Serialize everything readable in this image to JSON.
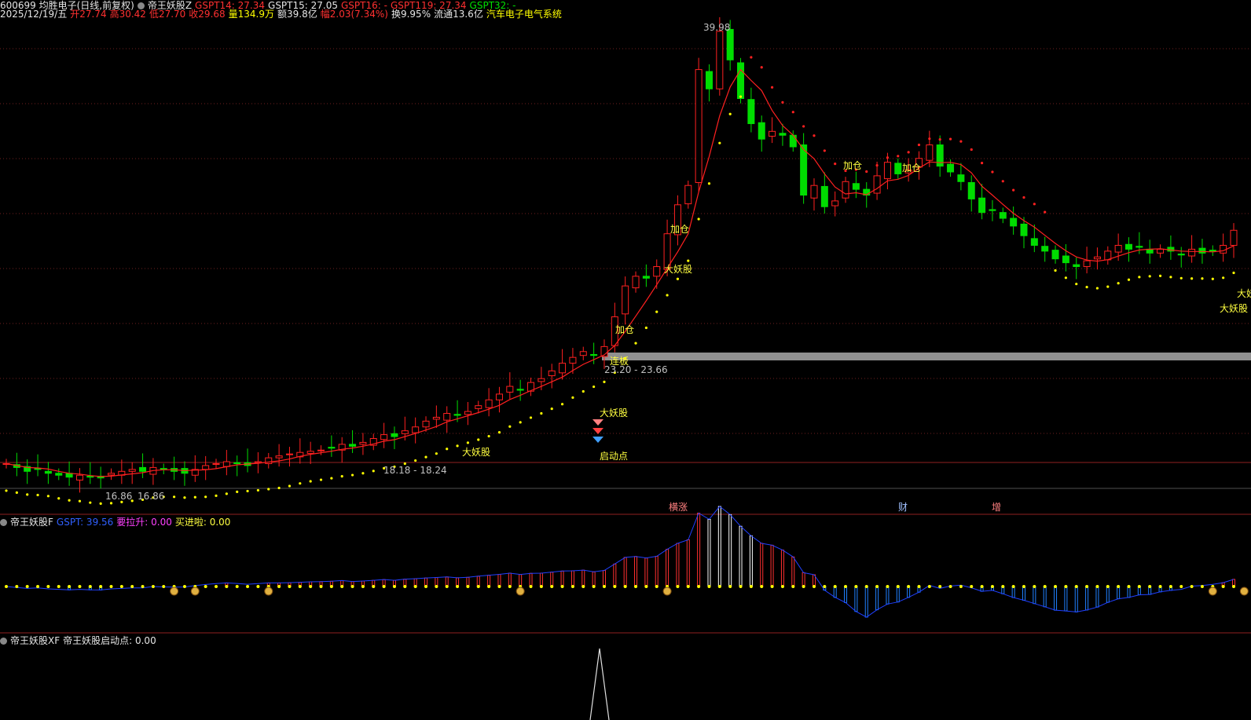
{
  "header": {
    "stock_line": "600699 均胜电子(日线,前复权)",
    "indicator_main": "帝王妖股Z",
    "gspt14": "GSPT14: 27.34",
    "gspt15": "GSPT15: 27.05",
    "gspt16": "GSPT16: -",
    "gspt119": "GSPT119: 27.34",
    "gspt32": "GSPT32: -",
    "date": "2025/12/19/五",
    "open": "开27.74",
    "high": "高30.42",
    "low": "低27.70",
    "close": "收29.68",
    "volume": "量134.9万",
    "amount": "额39.8亿",
    "change": "幅2.03(7.34%)",
    "turnover": "换9.95%",
    "float": "流通13.6亿",
    "sector": "汽车电子电气系统"
  },
  "main_chart": {
    "labels": {
      "peak": "39.98",
      "low_price": "16.86",
      "low_price_prefix": "16.86",
      "range1": "18.18 - 18.24",
      "range2": "23.20 - 23.66",
      "qidong": "启动点",
      "lianban": "连板",
      "dayaogu": "大妖股",
      "jiacang": "加仓",
      "dayaogu_cut": "大妖"
    },
    "event_markers": [
      "横涨",
      "财",
      "增"
    ],
    "colors": {
      "up": "#ff2020",
      "down": "#00dd00",
      "ma": "#ff2020",
      "dots": "#ffff00"
    }
  },
  "sub1": {
    "name": "帝王妖股F",
    "gspt": "GSPT: 39.56",
    "yaolasheng": "要拉升: 0.00",
    "maijinla": "买进啦: 0.00"
  },
  "sub2": {
    "name": "帝王妖股XF",
    "qidong": "帝王妖股启动点: 0.00"
  },
  "chart_data": {
    "type": "candlestick",
    "symbol": "600699",
    "last_bar": {
      "date": "2025/12/19",
      "open": 27.74,
      "high": 30.42,
      "low": 27.7,
      "close": 29.68,
      "change_pct": 7.34
    },
    "close_series": [
      17.6,
      17.4,
      17.2,
      17.3,
      17.1,
      17.0,
      16.9,
      17.0,
      16.9,
      16.86,
      17.1,
      17.2,
      17.3,
      17.2,
      17.4,
      17.3,
      17.2,
      17.1,
      17.3,
      17.5,
      17.6,
      17.7,
      17.6,
      17.5,
      17.7,
      17.9,
      18.0,
      18.1,
      18.18,
      18.24,
      18.3,
      18.4,
      18.6,
      18.5,
      18.7,
      18.9,
      19.1,
      19.0,
      19.3,
      19.5,
      19.8,
      20.0,
      20.2,
      20.1,
      20.3,
      20.6,
      20.9,
      21.2,
      21.6,
      21.4,
      21.8,
      22.0,
      22.4,
      22.8,
      23.1,
      23.4,
      23.2,
      23.66,
      25.2,
      26.8,
      27.3,
      27.2,
      27.8,
      29.5,
      31.0,
      32.0,
      38.0,
      37.0,
      39.98,
      38.5,
      36.5,
      35.2,
      34.4,
      34.8,
      34.6,
      34.0,
      31.5,
      32.0,
      30.9,
      31.2,
      32.2,
      31.8,
      31.5,
      32.5,
      33.2,
      32.6,
      32.8,
      33.4,
      34.1,
      33.0,
      32.7,
      32.2,
      31.3,
      30.6,
      30.7,
      30.3,
      29.9,
      29.4,
      28.9,
      28.6,
      28.2,
      28.0,
      27.8,
      28.1,
      28.3,
      28.6,
      28.9,
      28.7,
      28.8,
      28.5,
      28.7,
      28.6,
      28.4,
      28.7,
      28.5,
      28.6,
      28.9,
      29.68
    ]
  }
}
